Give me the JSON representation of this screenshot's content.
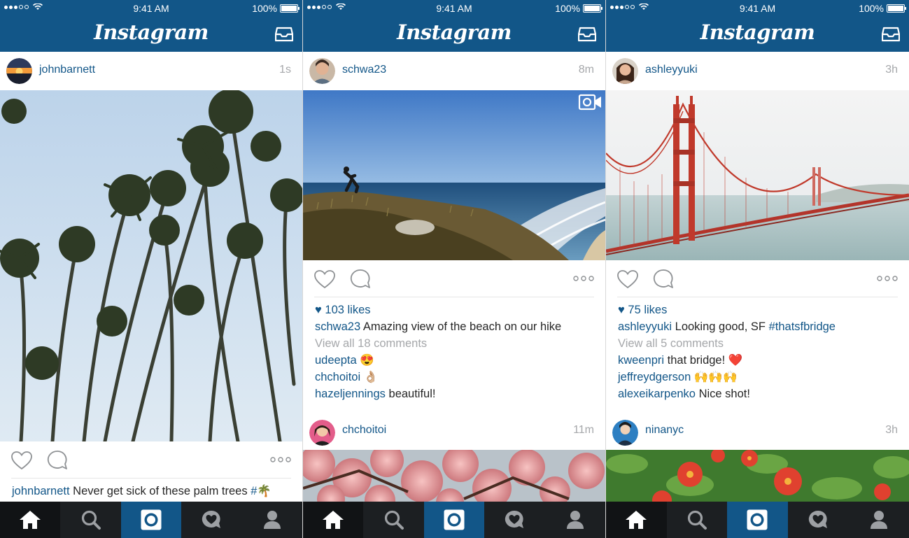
{
  "status_bar": {
    "time": "9:41 AM",
    "battery": "100%"
  },
  "app": {
    "logo": "Instagram",
    "inbox_icon": "inbox-icon"
  },
  "tab_bar": {
    "tabs": [
      {
        "name": "home",
        "icon": "home-icon",
        "active": true
      },
      {
        "name": "explore",
        "icon": "search-icon"
      },
      {
        "name": "camera",
        "icon": "camera-icon"
      },
      {
        "name": "activity",
        "icon": "heart-bubble-icon"
      },
      {
        "name": "profile",
        "icon": "profile-icon"
      }
    ]
  },
  "screens": [
    {
      "posts": [
        {
          "username": "johnbarnett",
          "ago": "1s",
          "photo": "palm trees against blue sky",
          "caption": {
            "user": "johnbarnett",
            "text": "Never get sick of these palm trees",
            "tag": "#🌴"
          }
        }
      ]
    },
    {
      "posts": [
        {
          "username": "schwa23",
          "ago": "8m",
          "photo": "hiker on coastal cliff above beach",
          "is_video": true,
          "likes": "103 likes",
          "caption": {
            "user": "schwa23",
            "text": "Amazing view of the beach on our hike"
          },
          "view_all": "View all 18 comments",
          "comments": [
            {
              "user": "udeepta",
              "text": "😍"
            },
            {
              "user": "chchoitoi",
              "text": "👌🏼"
            },
            {
              "user": "hazeljennings",
              "text": "beautiful!"
            }
          ]
        },
        {
          "username": "chchoitoi",
          "ago": "11m",
          "photo": "pink cherry blossoms"
        }
      ]
    },
    {
      "posts": [
        {
          "username": "ashleyyuki",
          "ago": "3h",
          "photo": "Golden Gate Bridge in fog",
          "likes": "75 likes",
          "caption": {
            "user": "ashleyyuki",
            "text": "Looking good, SF",
            "tag": "#thatsfbridge"
          },
          "view_all": "View all 5 comments",
          "comments": [
            {
              "user": "kweenpri",
              "text": "that bridge! ❤️"
            },
            {
              "user": "jeffreydgerson",
              "text": "🙌🙌🙌"
            },
            {
              "user": "alexeikarpenko",
              "text": "Nice shot!"
            }
          ]
        },
        {
          "username": "ninanyc",
          "ago": "3h",
          "photo": "red tropical flowers in green foliage"
        }
      ]
    }
  ]
}
